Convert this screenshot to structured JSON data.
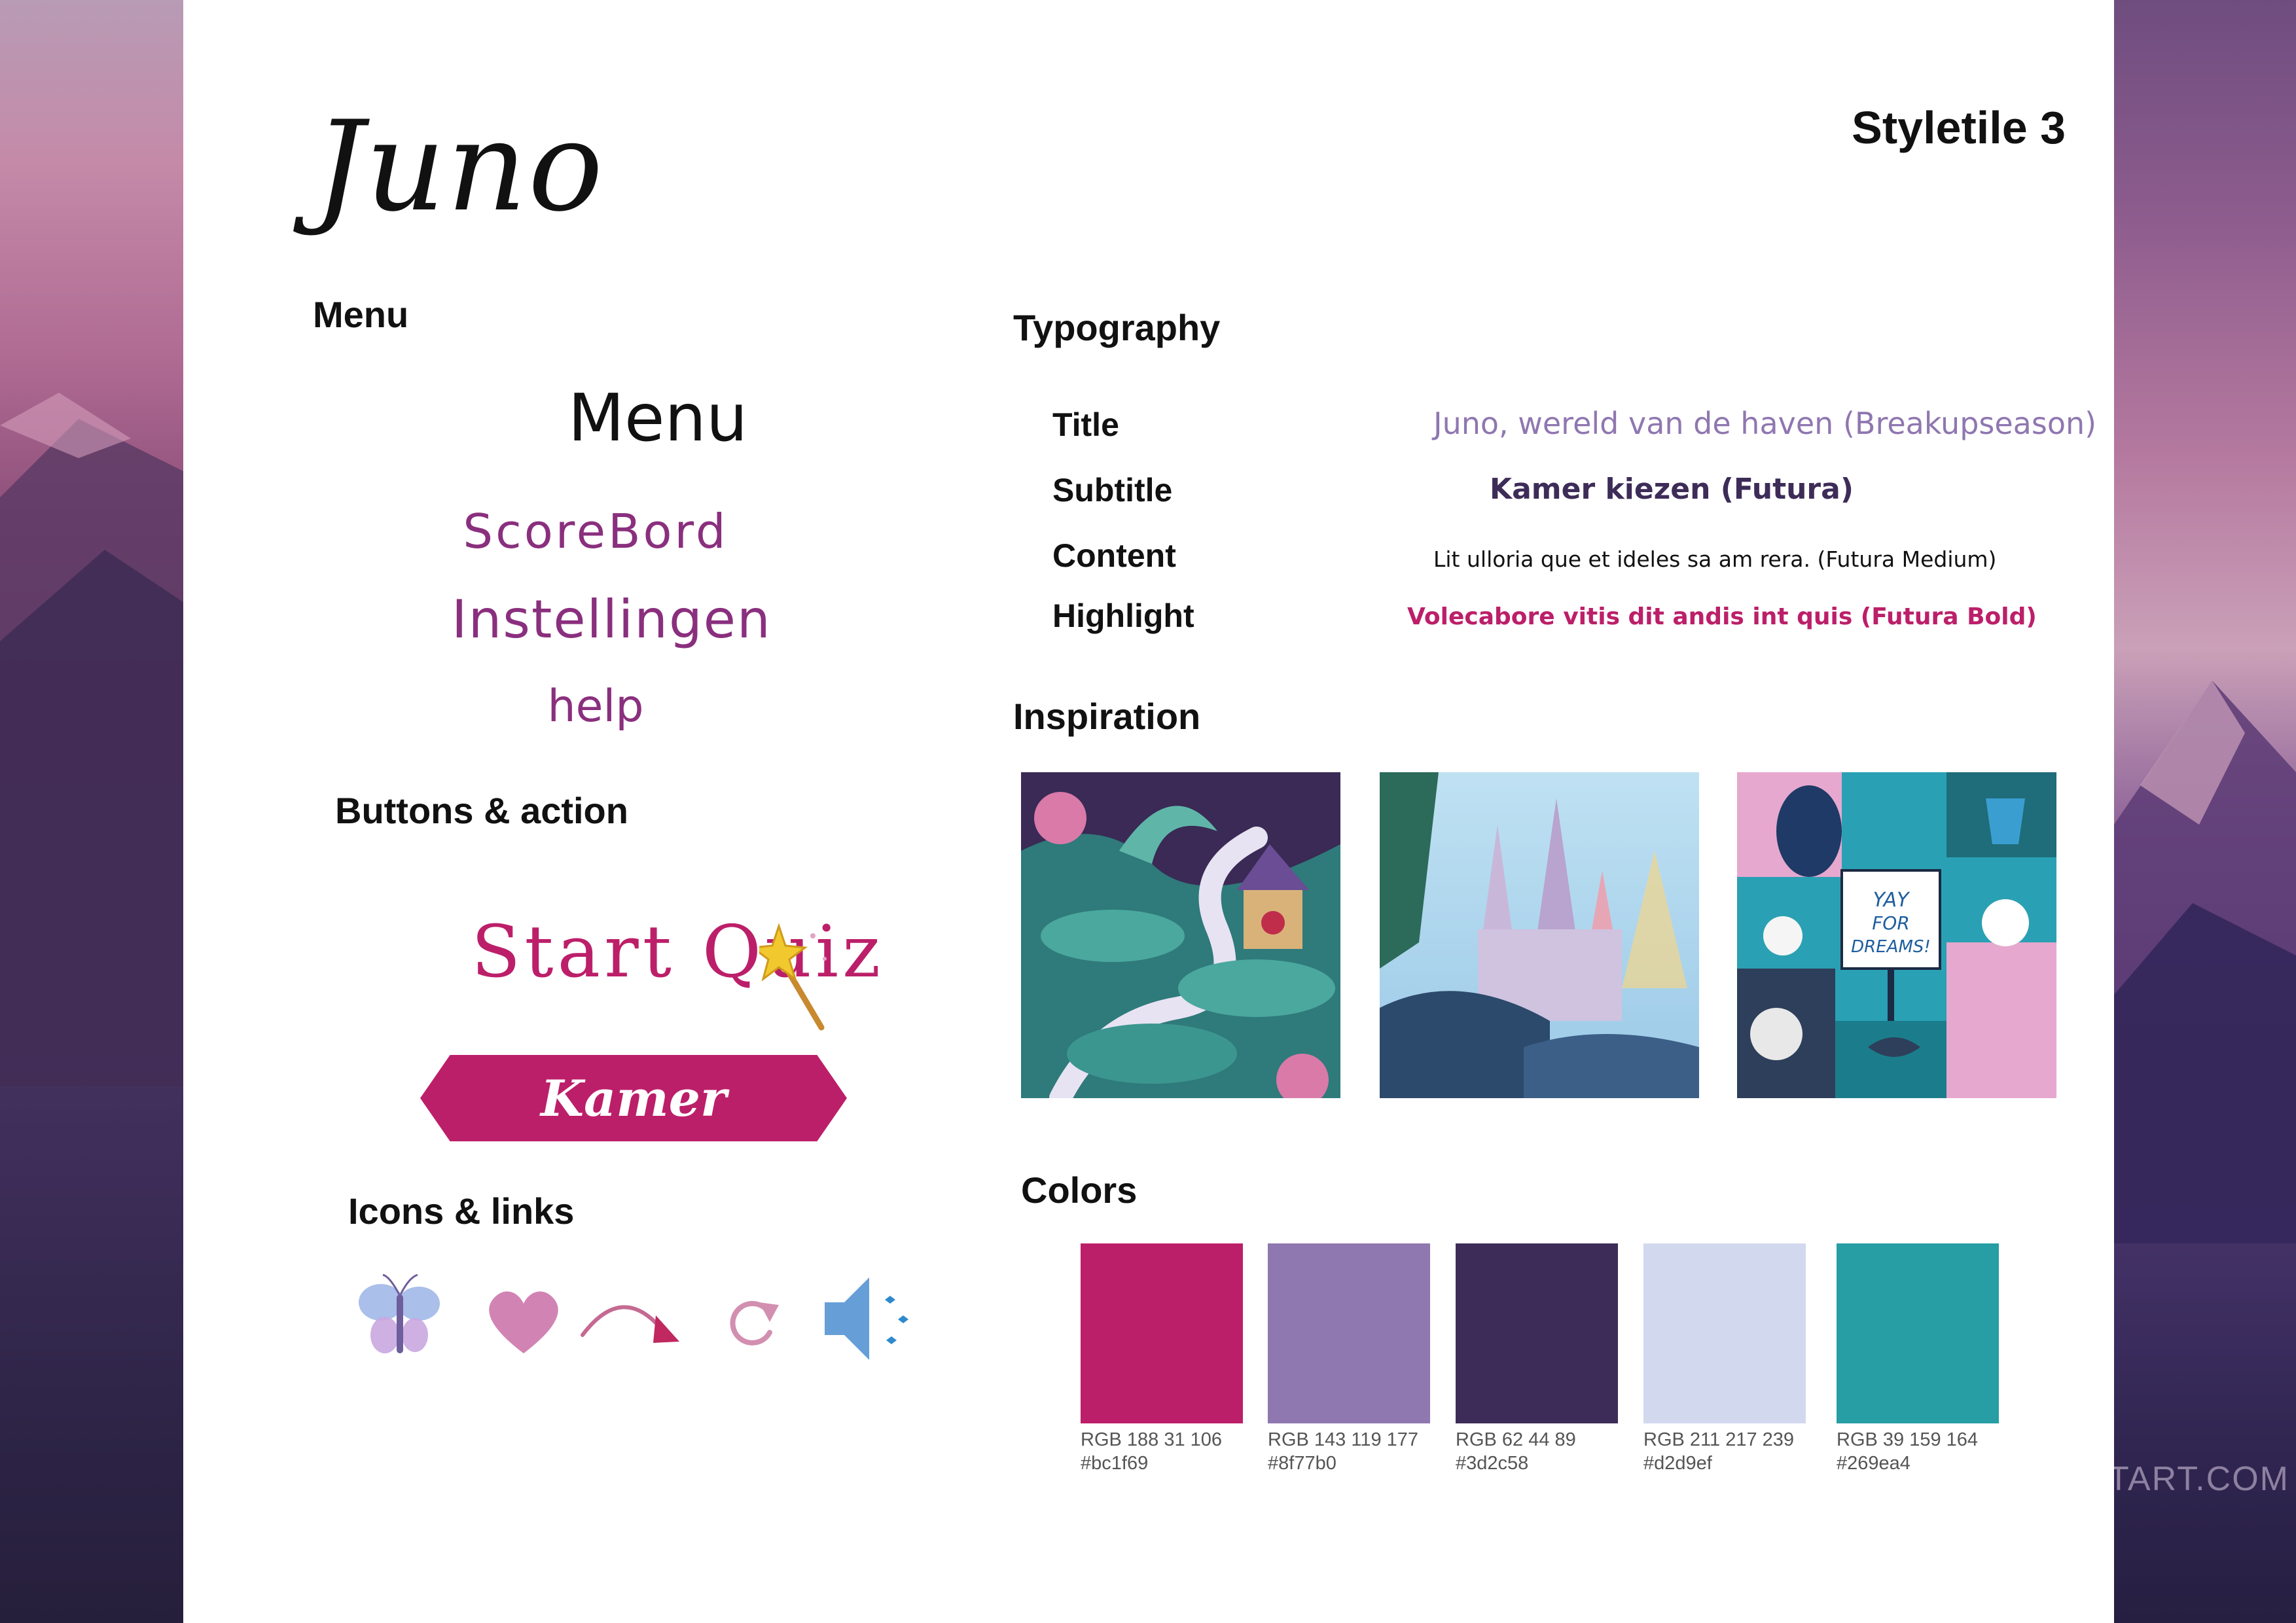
{
  "header": {
    "logo": "Juno",
    "styletile": "Styletile 3"
  },
  "menu_section": {
    "heading": "Menu",
    "items": [
      "Menu",
      "ScoreBord",
      "Instellingen",
      "help"
    ]
  },
  "buttons_section": {
    "heading": "Buttons & action",
    "start_quiz": "Start Quiz",
    "kamer": "Kamer"
  },
  "icons_section": {
    "heading": "Icons & links",
    "icons": [
      "butterfly-icon",
      "heart-icon",
      "curved-arrow-icon",
      "refresh-icon",
      "speaker-icon"
    ]
  },
  "typography": {
    "heading": "Typography",
    "rows": [
      {
        "label": "Title",
        "sample": "Juno, wereld van de haven (Breakupseason)"
      },
      {
        "label": "Subtitle",
        "sample": "Kamer kiezen (Futura)"
      },
      {
        "label": "Content",
        "sample": "Lit ulloria que et ideles sa am rera. (Futura Medium)"
      },
      {
        "label": "Highlight",
        "sample": "Volecabore vitis dit andis int quis (Futura Bold)"
      }
    ]
  },
  "inspiration": {
    "heading": "Inspiration",
    "poster_text": "YAY FOR DREAMS!"
  },
  "colors": {
    "heading": "Colors",
    "swatches": [
      {
        "rgb": "RGB  188 31 106",
        "hex": "#bc1f69"
      },
      {
        "rgb": "RGB  143 119 177",
        "hex": "#8f77b0"
      },
      {
        "rgb": "RGB  62 44 89",
        "hex": "#3d2c58"
      },
      {
        "rgb": "RGB  211 217 239",
        "hex": "#d2d9ef"
      },
      {
        "rgb": "RGB  39 159 164",
        "hex": "#269ea4"
      }
    ]
  },
  "background": {
    "watermark": "TART.COM"
  }
}
